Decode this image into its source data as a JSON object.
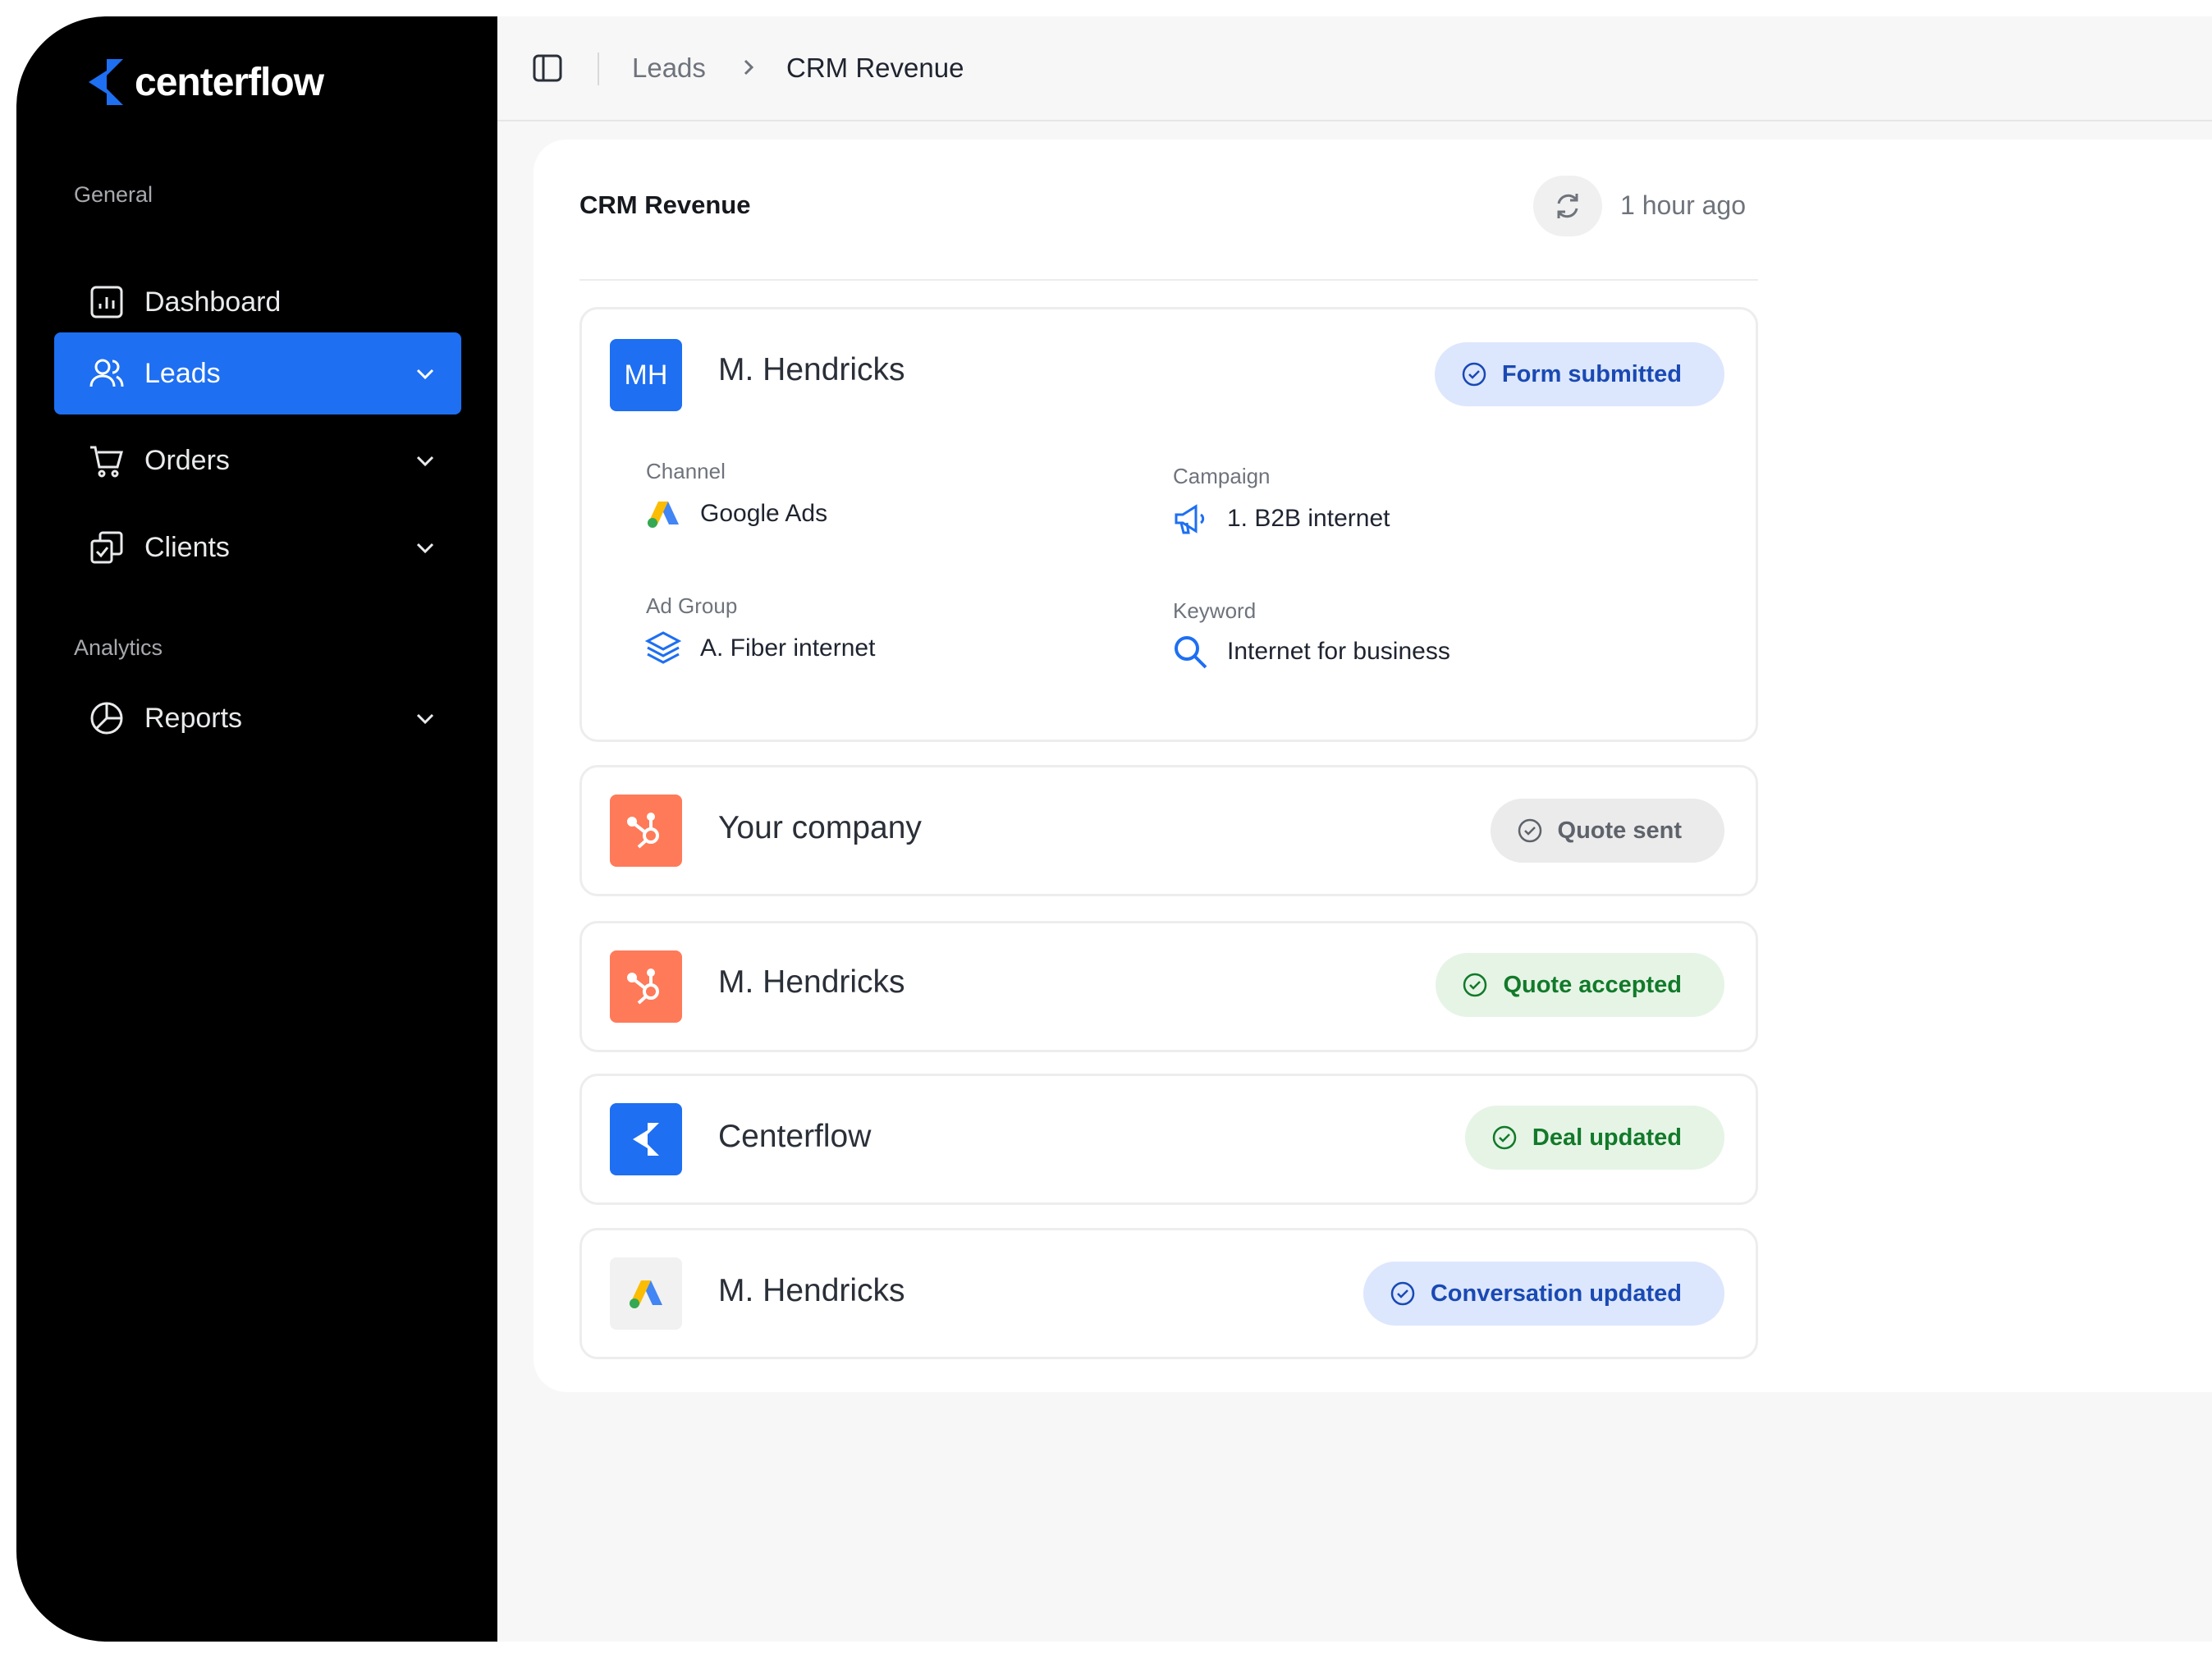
{
  "brand": {
    "name": "centerflow"
  },
  "sidebar": {
    "sections": [
      {
        "label": "General",
        "items": [
          {
            "label": "Dashboard",
            "icon": "dashboard-icon",
            "active": false,
            "expandable": false
          },
          {
            "label": "Leads",
            "icon": "users-icon",
            "active": true,
            "expandable": true
          },
          {
            "label": "Orders",
            "icon": "cart-icon",
            "active": false,
            "expandable": true
          },
          {
            "label": "Clients",
            "icon": "clients-icon",
            "active": false,
            "expandable": true
          }
        ]
      },
      {
        "label": "Analytics",
        "items": [
          {
            "label": "Reports",
            "icon": "pie-chart-icon",
            "active": false,
            "expandable": true
          }
        ]
      }
    ]
  },
  "breadcrumb": {
    "parent": "Leads",
    "current": "CRM Revenue"
  },
  "panel": {
    "title": "CRM Revenue",
    "updated": "1 hour ago",
    "cards": [
      {
        "avatar": "MH",
        "name": "M. Hendricks",
        "status": "Form submitted",
        "details": {
          "channel_label": "Channel",
          "channel_value": "Google Ads",
          "campaign_label": "Campaign",
          "campaign_value": "1. B2B internet",
          "adgroup_label": "Ad Group",
          "adgroup_value": "A. Fiber internet",
          "keyword_label": "Keyword",
          "keyword_value": "Internet for business"
        }
      },
      {
        "avatar_icon": "hubspot-icon",
        "name": "Your company",
        "status": "Quote sent"
      },
      {
        "avatar_icon": "hubspot-icon",
        "name": "M. Hendricks",
        "status": "Quote accepted"
      },
      {
        "avatar_icon": "centerflow-icon",
        "name": "Centerflow",
        "status": "Deal updated"
      },
      {
        "avatar_icon": "google-ads-icon",
        "name": "M. Hendricks",
        "status": "Conversation updated"
      }
    ]
  },
  "colors": {
    "accent": "#1e6ff2",
    "hubspot": "#ff7a59",
    "badge_blue_bg": "#dce7fd",
    "badge_green_bg": "#e6f4e6",
    "badge_grey_bg": "#ebebeb"
  }
}
